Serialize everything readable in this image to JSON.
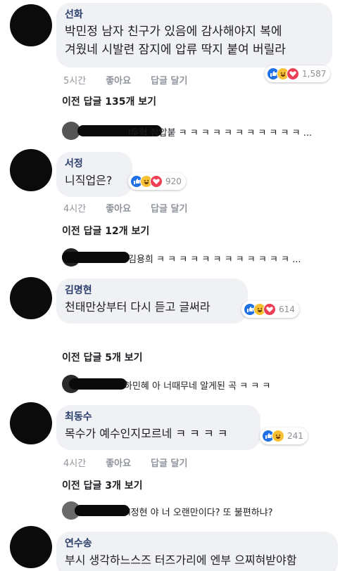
{
  "comments": [
    {
      "author": "선화",
      "lines": [
        "박민정 남자 친구가 있음에 감사해야지 복에",
        "겨웠네 시발련 잠지에 압류 딱지 붙여 버릴라"
      ],
      "time": "5시간",
      "like_label": "좋아요",
      "reply_label": "답글 달기",
      "reactions": [
        "like",
        "haha",
        "love"
      ],
      "reaction_count": "1,587",
      "prev_replies": "이전 답글 135개 보기",
      "reply_preview": "l두혁 잠압붙 ㅋ ㅋ ㅋ ㅋ ㅋ ㅋ ㅋ ㅋ ㅋ ㅋ ㅋ ..."
    },
    {
      "author": "서정",
      "lines": [
        "니직업은?"
      ],
      "time": "4시간",
      "like_label": "좋아요",
      "reply_label": "답글 달기",
      "reactions": [
        "like",
        "haha",
        "love"
      ],
      "reaction_count": "920",
      "prev_replies": "이전 답글 12개 보기",
      "reply_preview": "김용희 ㅋ ㅋ ㅋ ㅋ ㅋ ㅋ ㅋ ㅋ ㅋ ㅋ ㅋ ㅋ ..."
    },
    {
      "author": "김명현",
      "lines": [
        "천태만상부터 다시 듣고 글써라"
      ],
      "reactions": [
        "like",
        "haha",
        "love"
      ],
      "reaction_count": "614",
      "prev_replies": "이전 답글 5개 보기",
      "reply_preview": "하민혜 아 너때무네 알게된 곡 ㅋ ㅋ ㅋ"
    },
    {
      "author": "최동수",
      "lines": [
        "목수가 예수인지모르네 ㅋ ㅋ ㅋ ㅋ"
      ],
      "time": "4시간",
      "like_label": "좋아요",
      "reply_label": "답글 달기",
      "reactions": [
        "like",
        "haha"
      ],
      "reaction_count": "241",
      "prev_replies": "이전 답글 3개 보기",
      "reply_preview": "l정현 야 너 오랜만이다? 또 불편하냐?"
    },
    {
      "author": "연수송",
      "lines": [
        "부시 생각하느스즈 터즈가리에 엔부 으찌혀받야함"
      ]
    }
  ],
  "colors": {
    "like": "#1f6fe5",
    "haha": "#f7c035",
    "love": "#ee3e55",
    "bubble": "#f0f1f4",
    "author": "#2a3e6b"
  }
}
